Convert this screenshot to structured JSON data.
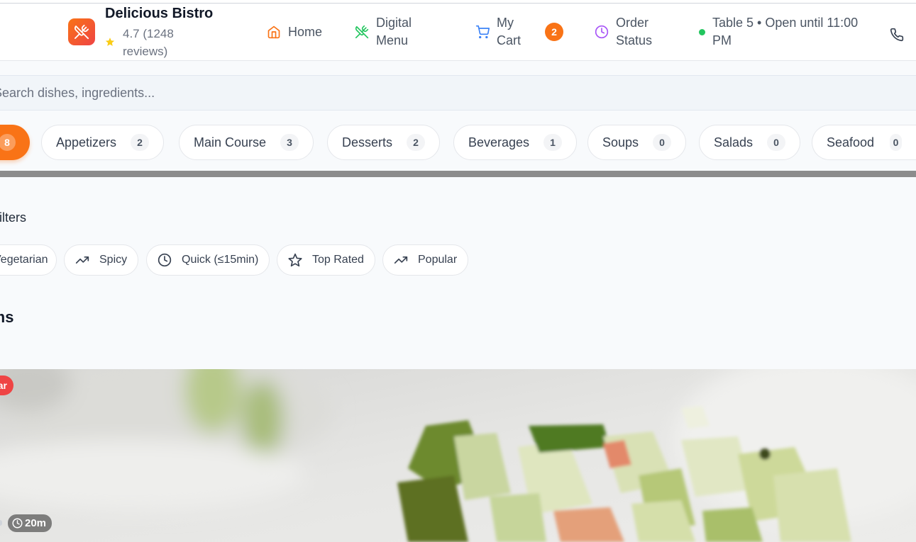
{
  "header": {
    "brand_name": "Delicious Bistro",
    "rating": "4.7 (1248 reviews)",
    "nav": {
      "home": "Home",
      "menu": "Digital Menu",
      "cart": "My Cart",
      "cart_count": "2",
      "status": "Order Status"
    },
    "table_info": "Table 5 • Open until 11:00 PM"
  },
  "search": {
    "placeholder": "Search dishes, ingredients..."
  },
  "categories": {
    "all_count": "8",
    "items": [
      {
        "label": "Appetizers",
        "count": "2"
      },
      {
        "label": "Main Course",
        "count": "3"
      },
      {
        "label": "Desserts",
        "count": "2"
      },
      {
        "label": "Beverages",
        "count": "1"
      },
      {
        "label": "Soups",
        "count": "0"
      },
      {
        "label": "Salads",
        "count": "0"
      },
      {
        "label": "Seafood",
        "count": "0"
      }
    ]
  },
  "filters": {
    "title": "Filters",
    "chips": [
      {
        "label": "Vegetarian"
      },
      {
        "label": "Spicy",
        "icon": "trending-up-icon"
      },
      {
        "label": "Quick (≤15min)",
        "icon": "clock-icon"
      },
      {
        "label": "Top Rated",
        "icon": "star-outline-icon"
      },
      {
        "label": "Popular",
        "icon": "trending-up-icon"
      }
    ]
  },
  "section": {
    "title": "Items"
  },
  "card": {
    "badge": "Popular",
    "time": "20m"
  },
  "colors": {
    "accent": "#f97316",
    "badge_red": "#ef4444",
    "open_green": "#22c55e",
    "menu_green": "#22c55e",
    "cart_blue": "#3b82f6",
    "status_purple": "#a855f7"
  }
}
